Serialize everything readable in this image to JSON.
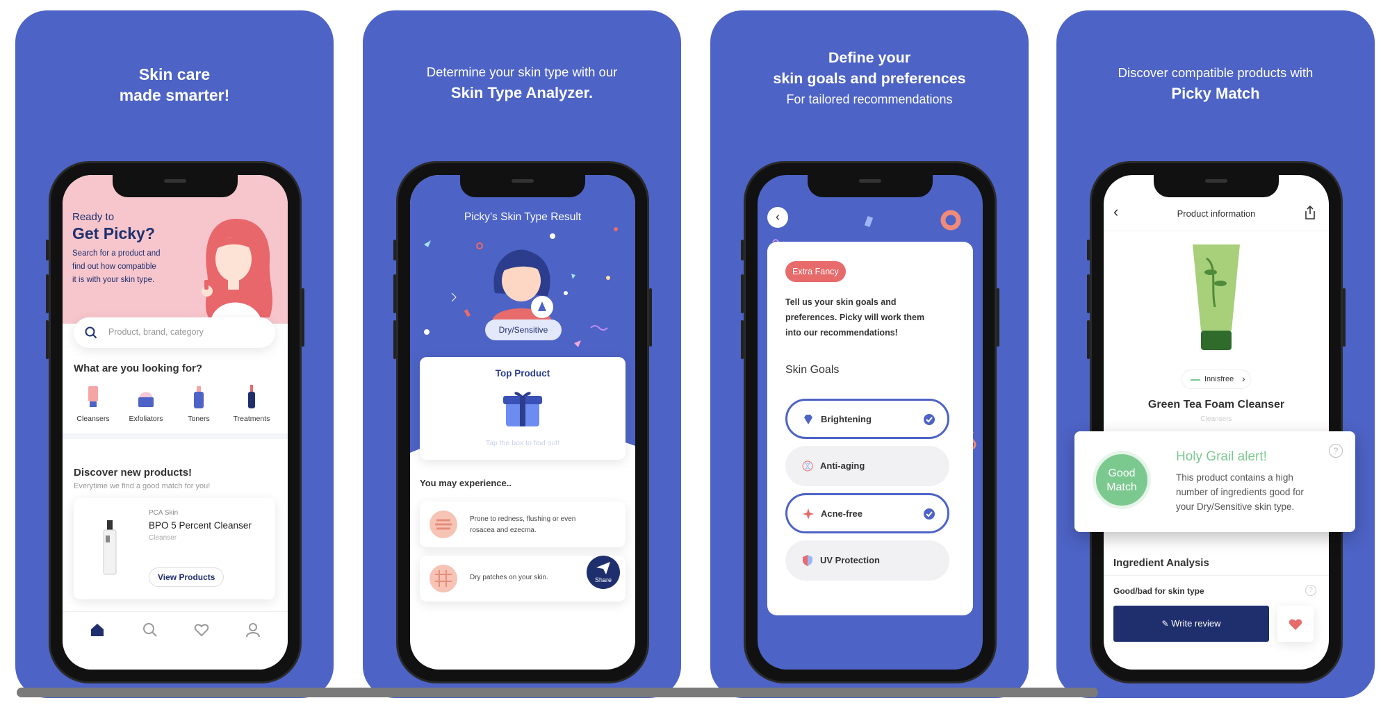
{
  "panel1": {
    "heading": [
      "Skin care",
      "made smarter!"
    ],
    "hero_small": "Ready to",
    "hero_big": "Get Picky?",
    "hero_desc": [
      "Search for a product and",
      "find out how compatible",
      "it is with your skin type."
    ],
    "search_placeholder": "Product, brand, category",
    "section_title": "What are you looking for?",
    "categories": [
      "Cleansers",
      "Exfoliators",
      "Toners",
      "Treatments"
    ],
    "discover_title": "Discover new products!",
    "discover_sub": "Everytime we find a good match for you!",
    "product": {
      "brand": "PCA Skin",
      "name": "BPO 5 Percent Cleanser",
      "type": "Cleanser",
      "button": "View Products"
    },
    "nav": [
      "home-icon",
      "search-icon",
      "heart-icon",
      "profile-icon"
    ]
  },
  "panel2": {
    "heading_line1": "Determine your skin type with our",
    "heading_line2": "Skin Type Analyzer.",
    "result_title": "Picky’s Skin Type Result",
    "result_badge": "Dry/Sensitive",
    "top_product": "Top Product",
    "tap_text": "Tap the box to find out!",
    "experience_title": "You may experience..",
    "experiences": [
      [
        "Prone to redness, flushing or even",
        "rosacea and ezecma."
      ],
      [
        "Dry patches on your skin."
      ]
    ],
    "share": "Share"
  },
  "panel3": {
    "heading": [
      "Define your",
      "skin goals and preferences"
    ],
    "sub": "For tailored recommendations",
    "tag": "Extra Fancy",
    "desc": [
      "Tell us your skin goals and",
      "preferences. Picky will work them",
      "into our recommendations!"
    ],
    "goals_title": "Skin Goals",
    "goals": [
      {
        "label": "Brightening",
        "selected": true
      },
      {
        "label": "Anti-aging",
        "selected": false
      },
      {
        "label": "Acne-free",
        "selected": true
      },
      {
        "label": "UV Protection",
        "selected": false
      }
    ]
  },
  "panel4": {
    "heading_line1": "Discover compatible products with",
    "heading_line2": "Picky Match",
    "header_title": "Product information",
    "brand_chip": "Innisfree",
    "product_name": "Green Tea Foam Cleanser",
    "product_type": "Cleansers",
    "match_badge": [
      "Good",
      "Match"
    ],
    "alert_title": "Holy Grail alert!",
    "alert_text": [
      "This product contains a high",
      "number of ingredients good for",
      "your Dry/Sensitive skin type."
    ],
    "ingredient_title": "Ingredient Analysis",
    "good_bad": "Good/bad for skin type",
    "write_review": "Write review"
  },
  "colors": {
    "brand_blue": "#4D63C5",
    "navy": "#1F2F6E",
    "coral": "#E86B6B",
    "green": "#7CC98F"
  }
}
